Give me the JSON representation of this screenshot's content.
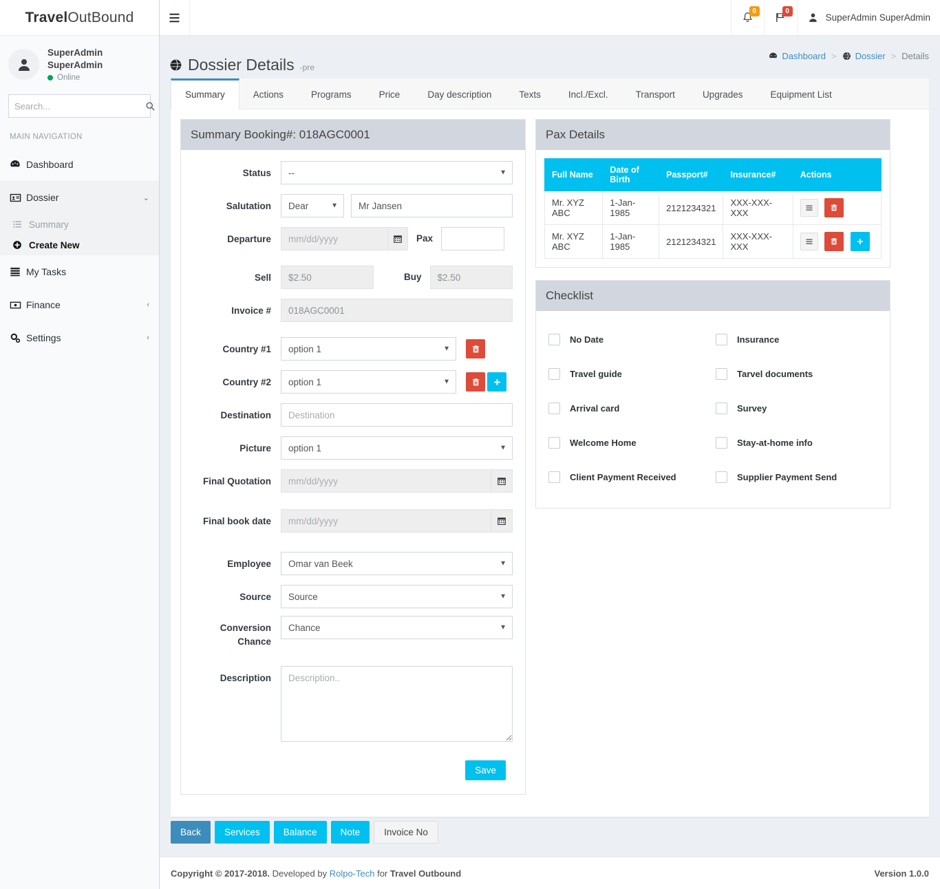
{
  "brand": {
    "bold": "Travel",
    "light": "OutBound"
  },
  "user_panel": {
    "name": "SuperAdmin SuperAdmin",
    "status": "Online"
  },
  "search": {
    "placeholder": "Search...",
    "value": ""
  },
  "sidebar": {
    "nav_header": "MAIN NAVIGATION",
    "items": [
      {
        "label": "Dashboard",
        "icon": "dashboard-icon",
        "arrow": ""
      },
      {
        "label": "Dossier",
        "icon": "id-card-icon",
        "arrow": "⌄"
      },
      {
        "label": "My Tasks",
        "icon": "tasks-icon",
        "arrow": ""
      },
      {
        "label": "Finance",
        "icon": "money-icon",
        "arrow": "‹"
      },
      {
        "label": "Settings",
        "icon": "gears-icon",
        "arrow": "‹"
      }
    ],
    "dossier_sub": [
      {
        "label": "Summary",
        "icon": "list-icon"
      },
      {
        "label": "Create New",
        "icon": "plus-circle-icon"
      }
    ]
  },
  "topbar": {
    "notifications_badge": "0",
    "flags_badge": "0",
    "user_name": "SuperAdmin SuperAdmin"
  },
  "header": {
    "title": "Dossier Details",
    "subtitle": "-pre",
    "breadcrumb": [
      {
        "label": "Dashboard",
        "icon": "dashboard-icon"
      },
      {
        "label": "Dossier",
        "icon": "globe-icon"
      },
      {
        "label": "Details",
        "icon": ""
      }
    ],
    "separator": ">"
  },
  "tabs": [
    {
      "label": "Summary",
      "active": true
    },
    {
      "label": "Actions",
      "active": false
    },
    {
      "label": "Programs",
      "active": false
    },
    {
      "label": "Price",
      "active": false
    },
    {
      "label": "Day description",
      "active": false
    },
    {
      "label": "Texts",
      "active": false
    },
    {
      "label": "Incl./Excl.",
      "active": false
    },
    {
      "label": "Transport",
      "active": false
    },
    {
      "label": "Upgrades",
      "active": false
    },
    {
      "label": "Equipment List",
      "active": false
    }
  ],
  "summary": {
    "box_title": "Summary Booking#: 018AGC0001",
    "labels": {
      "status": "Status",
      "salutation": "Salutation",
      "departure": "Departure",
      "pax": "Pax",
      "sell": "Sell",
      "buy": "Buy",
      "invoice": "Invoice #",
      "country1": "Country #1",
      "country2": "Country #2",
      "destination": "Destination",
      "picture": "Picture",
      "final_quotation": "Final Quotation",
      "final_book_date": "Final book date",
      "employee": "Employee",
      "source": "Source",
      "conversion_chance": "Conversion Chance",
      "description": "Description"
    },
    "values": {
      "status": "--",
      "salutation_select": "Dear",
      "salutation_name": "Mr Jansen",
      "departure_placeholder": "mm/dd/yyyy",
      "pax": "",
      "sell": "$2.50",
      "buy": "$2.50",
      "invoice": "018AGC0001",
      "country1": "option 1",
      "country2": "option 1",
      "destination_placeholder": "Destination",
      "picture": "option 1",
      "final_quotation_placeholder": "mm/dd/yyyy",
      "final_book_date_placeholder": "mm/dd/yyyy",
      "employee": "Omar van Beek",
      "source": "Source",
      "conversion_chance": "Chance",
      "description_placeholder": "Description.."
    },
    "save_label": "Save"
  },
  "pax_details": {
    "box_title": "Pax Details",
    "columns": [
      "Full Name",
      "Date of Birth",
      "Passport#",
      "Insurance#",
      "Actions"
    ],
    "rows": [
      {
        "full_name": "Mr. XYZ ABC",
        "dob": "1-Jan-1985",
        "passport": "2121234321",
        "insurance": "XXX-XXX-XXX",
        "has_add": false
      },
      {
        "full_name": "Mr. XYZ ABC",
        "dob": "1-Jan-1985",
        "passport": "2121234321",
        "insurance": "XXX-XXX-XXX",
        "has_add": true
      }
    ]
  },
  "checklist": {
    "box_title": "Checklist",
    "items": [
      {
        "label": "No Date",
        "checked": false
      },
      {
        "label": "Insurance",
        "checked": false
      },
      {
        "label": "Travel guide",
        "checked": false
      },
      {
        "label": "Tarvel documents",
        "checked": false
      },
      {
        "label": "Arrival card",
        "checked": false
      },
      {
        "label": "Survey",
        "checked": false
      },
      {
        "label": "Welcome Home",
        "checked": false
      },
      {
        "label": "Stay-at-home info",
        "checked": false
      },
      {
        "label": "Client Payment Received",
        "checked": false
      },
      {
        "label": "Supplier Payment Send",
        "checked": false
      }
    ]
  },
  "bottom_buttons": [
    {
      "label": "Back",
      "style": "blue"
    },
    {
      "label": "Services",
      "style": "cyan"
    },
    {
      "label": "Balance",
      "style": "cyan"
    },
    {
      "label": "Note",
      "style": "cyan"
    },
    {
      "label": "Invoice No",
      "style": "default"
    }
  ],
  "footer": {
    "copyright_bold": "Copyright © 2017-2018.",
    "developed_by": " Developed by ",
    "company_link": "Rolpo-Tech",
    "for_text": " for ",
    "product": "Travel Outbound",
    "version": "Version 1.0.0"
  },
  "colors": {
    "accent_cyan": "#00c0ef",
    "accent_blue": "#3c8dbc",
    "danger_red": "#dd4b39",
    "warn_orange": "#f39c12",
    "online_green": "#00a65a",
    "box_header_grey": "#d2d6de",
    "page_bg": "#ecf0f5"
  }
}
